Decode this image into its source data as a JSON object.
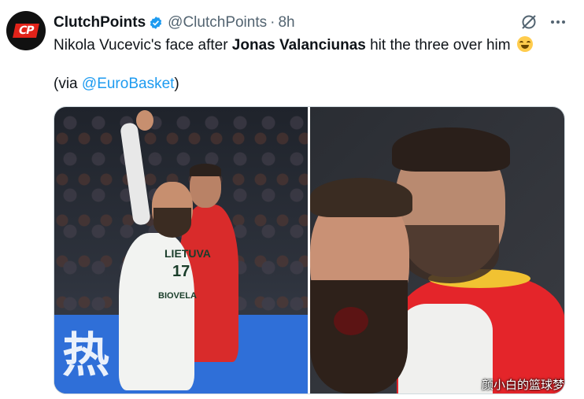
{
  "tweet": {
    "display_name": "ClutchPoints",
    "handle": "@ClutchPoints",
    "separator": "·",
    "time": "8h",
    "text_before": "Nikola Vucevic's face after ",
    "text_bold": "Jonas Valanciunas",
    "text_after": " hit the three over him",
    "emoji": "laughing-emoji",
    "via_prefix": "(via ",
    "via_mention": "@EuroBasket",
    "via_suffix": ")"
  },
  "media": {
    "left_photo": {
      "banner_text": "热",
      "jersey_text": "LIETUVA",
      "jersey_number": "17",
      "sponsor": "BIOVELA"
    }
  },
  "watermark": "颜小白的篮球梦",
  "colors": {
    "accent": "#1d9bf0",
    "text": "#0f1419",
    "muted": "#536471",
    "brand_red": "#e2231a"
  },
  "icons": {
    "verified": "verified-badge-icon",
    "grok": "grok-icon",
    "more": "more-options-icon"
  }
}
